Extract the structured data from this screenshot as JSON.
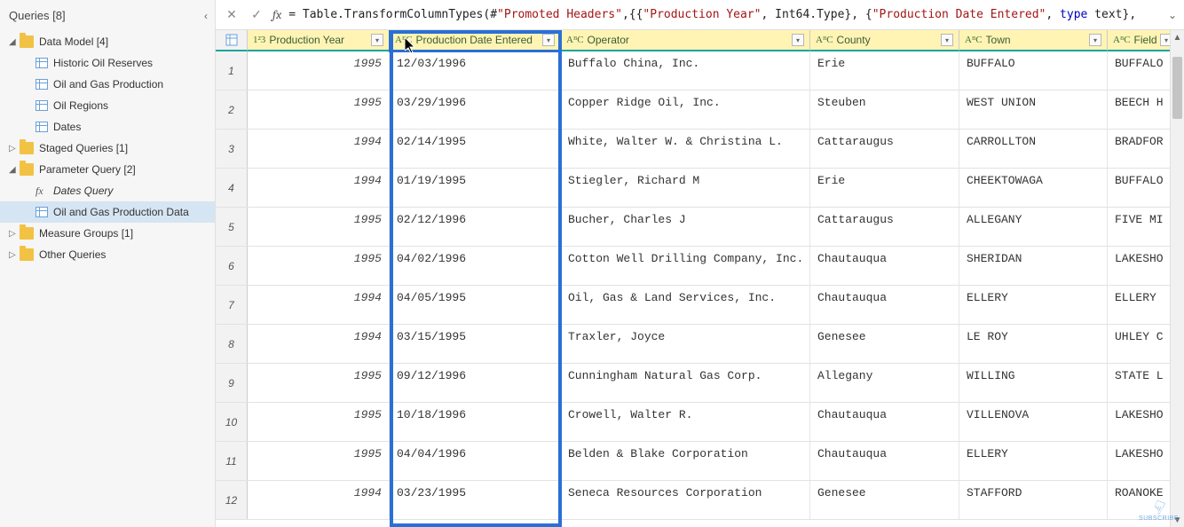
{
  "queries_pane": {
    "title": "Queries [8]",
    "groups": [
      {
        "label": "Data Model [4]",
        "expanded": true,
        "items": [
          {
            "label": "Historic Oil Reserves",
            "kind": "table"
          },
          {
            "label": "Oil and Gas Production",
            "kind": "table"
          },
          {
            "label": "Oil Regions",
            "kind": "table"
          },
          {
            "label": "Dates",
            "kind": "table"
          }
        ]
      },
      {
        "label": "Staged Queries [1]",
        "expanded": false,
        "items": []
      },
      {
        "label": "Parameter Query [2]",
        "expanded": true,
        "items": [
          {
            "label": "Dates Query",
            "kind": "fx"
          },
          {
            "label": "Oil and Gas Production Data",
            "kind": "table",
            "selected": true
          }
        ]
      },
      {
        "label": "Measure Groups [1]",
        "expanded": false,
        "items": []
      },
      {
        "label": "Other Queries",
        "expanded": false,
        "items": []
      }
    ]
  },
  "formula_bar": {
    "prefix": "= Table.TransformColumnTypes(#",
    "q1": "\"Promoted Headers\"",
    "mid": ",{{",
    "q2": "\"Production Year\"",
    "mid2": ", Int64.Type}, {",
    "q3": "\"Production Date Entered\"",
    "mid3": ", ",
    "kw": "type",
    "mid4": " text},"
  },
  "columns": [
    {
      "key": "year",
      "label": "Production Year",
      "type_icon": "1²3",
      "width_class": "col-year"
    },
    {
      "key": "date",
      "label": "Production Date Entered",
      "type_icon": "AᴮC",
      "width_class": "col-date",
      "selected": true
    },
    {
      "key": "op",
      "label": "Operator",
      "type_icon": "AᴮC",
      "width_class": "col-op"
    },
    {
      "key": "cty",
      "label": "County",
      "type_icon": "AᴮC",
      "width_class": "col-cty"
    },
    {
      "key": "town",
      "label": "Town",
      "type_icon": "AᴮC",
      "width_class": "col-town"
    },
    {
      "key": "field",
      "label": "Field",
      "type_icon": "AᴮC",
      "width_class": "col-field"
    }
  ],
  "rows": [
    {
      "n": "1",
      "year": "1995",
      "date": "12/03/1996",
      "op": "Buffalo China, Inc.",
      "cty": "Erie",
      "town": "BUFFALO",
      "field": "BUFFALO"
    },
    {
      "n": "2",
      "year": "1995",
      "date": "03/29/1996",
      "op": "Copper Ridge Oil, Inc.",
      "cty": "Steuben",
      "town": "WEST UNION",
      "field": "BEECH H"
    },
    {
      "n": "3",
      "year": "1994",
      "date": "02/14/1995",
      "op": "White, Walter W. & Christina L.",
      "cty": "Cattaraugus",
      "town": "CARROLLTON",
      "field": "BRADFOR"
    },
    {
      "n": "4",
      "year": "1994",
      "date": "01/19/1995",
      "op": "Stiegler, Richard M",
      "cty": "Erie",
      "town": "CHEEKTOWAGA",
      "field": "BUFFALO"
    },
    {
      "n": "5",
      "year": "1995",
      "date": "02/12/1996",
      "op": "Bucher, Charles J",
      "cty": "Cattaraugus",
      "town": "ALLEGANY",
      "field": "FIVE MI"
    },
    {
      "n": "6",
      "year": "1995",
      "date": "04/02/1996",
      "op": "Cotton Well Drilling Company,  Inc.",
      "cty": "Chautauqua",
      "town": "SHERIDAN",
      "field": "LAKESHO"
    },
    {
      "n": "7",
      "year": "1994",
      "date": "04/05/1995",
      "op": "Oil, Gas & Land Services, Inc.",
      "cty": "Chautauqua",
      "town": "ELLERY",
      "field": "ELLERY"
    },
    {
      "n": "8",
      "year": "1994",
      "date": "03/15/1995",
      "op": "Traxler, Joyce",
      "cty": "Genesee",
      "town": "LE ROY",
      "field": "UHLEY C"
    },
    {
      "n": "9",
      "year": "1995",
      "date": "09/12/1996",
      "op": "Cunningham Natural Gas Corp.",
      "cty": "Allegany",
      "town": "WILLING",
      "field": "STATE L"
    },
    {
      "n": "10",
      "year": "1995",
      "date": "10/18/1996",
      "op": "Crowell, Walter R.",
      "cty": "Chautauqua",
      "town": "VILLENOVA",
      "field": "LAKESHO"
    },
    {
      "n": "11",
      "year": "1995",
      "date": "04/04/1996",
      "op": "Belden & Blake Corporation",
      "cty": "Chautauqua",
      "town": "ELLERY",
      "field": "LAKESHO"
    },
    {
      "n": "12",
      "year": "1994",
      "date": "03/23/1995",
      "op": "Seneca Resources Corporation",
      "cty": "Genesee",
      "town": "STAFFORD",
      "field": "ROANOKE"
    }
  ],
  "watermark": "SUBSCRIBE"
}
